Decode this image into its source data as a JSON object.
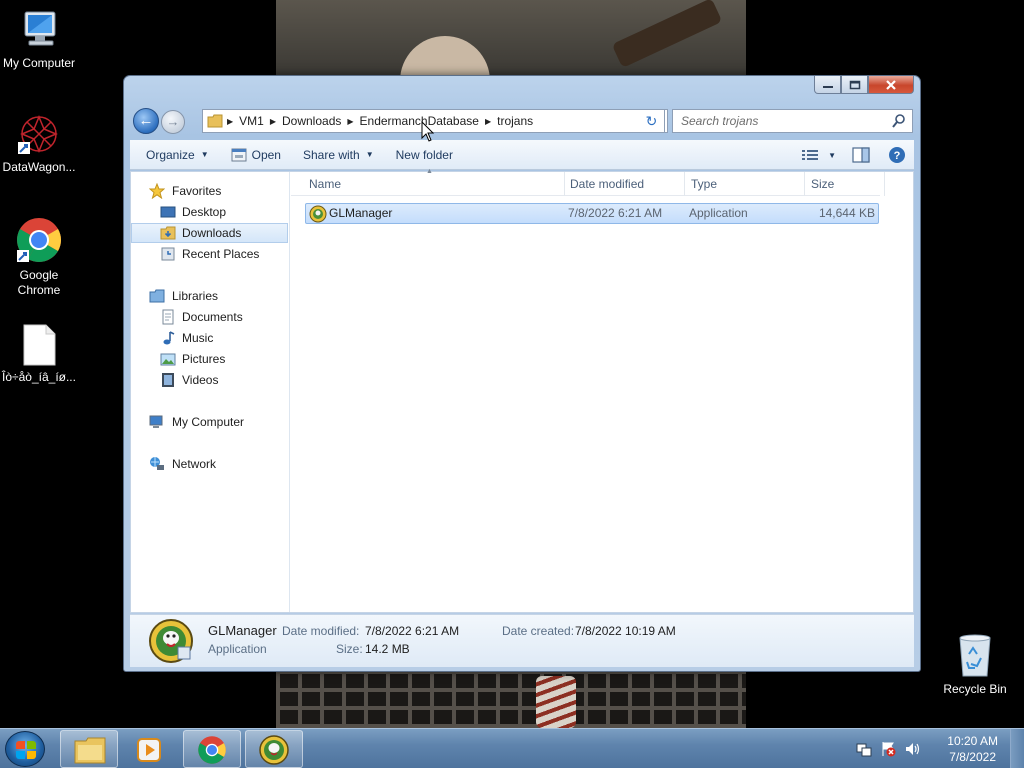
{
  "desktop": {
    "icons": [
      {
        "label": "My Computer"
      },
      {
        "label": "DataWagon..."
      },
      {
        "label": "Google Chrome"
      },
      {
        "label": "Îò÷åò_íâ_íø..."
      },
      {
        "label": "Recycle Bin"
      }
    ]
  },
  "window": {
    "breadcrumbs": [
      "VM1",
      "Downloads",
      "EndermanchDatabase",
      "trojans"
    ],
    "search_placeholder": "Search trojans",
    "toolbar": {
      "organize": "Organize",
      "open": "Open",
      "share_with": "Share with",
      "new_folder": "New folder"
    },
    "nav": {
      "favorites": "Favorites",
      "desktop": "Desktop",
      "downloads": "Downloads",
      "recent_places": "Recent Places",
      "libraries": "Libraries",
      "documents": "Documents",
      "music": "Music",
      "pictures": "Pictures",
      "videos": "Videos",
      "my_computer": "My Computer",
      "network": "Network"
    },
    "columns": {
      "name": "Name",
      "date_modified": "Date modified",
      "type": "Type",
      "size": "Size"
    },
    "files": [
      {
        "name": "GLManager",
        "date_modified": "7/8/2022 6:21 AM",
        "type": "Application",
        "size": "14,644 KB"
      }
    ],
    "details": {
      "name": "GLManager",
      "type": "Application",
      "date_modified_label": "Date modified:",
      "date_modified": "7/8/2022 6:21 AM",
      "date_created_label": "Date created:",
      "date_created": "7/8/2022 10:19 AM",
      "size_label": "Size:",
      "size": "14.2 MB"
    }
  },
  "taskbar": {
    "time": "10:20 AM",
    "date": "7/8/2022"
  },
  "colors": {
    "selection": "#cfe3fb",
    "taskbar": "#5f84ad",
    "window_frame": "#b7cde6"
  }
}
